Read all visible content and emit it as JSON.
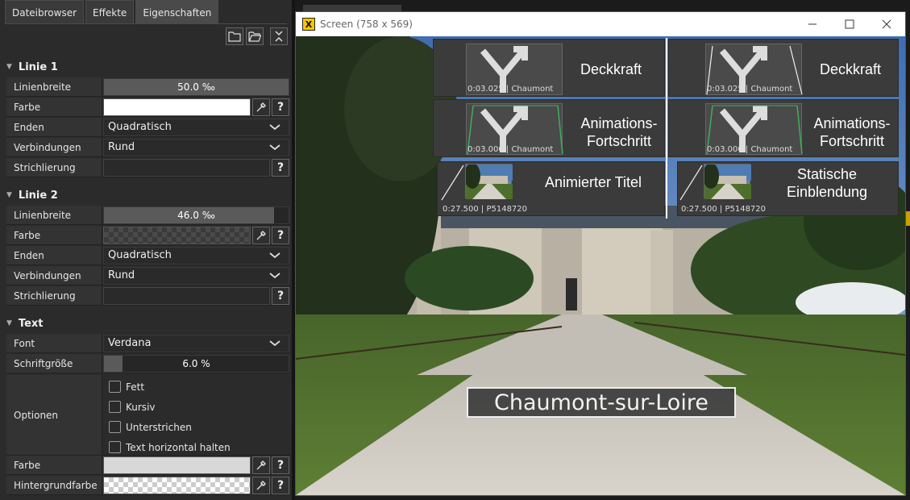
{
  "tabs": [
    "Dateibrowser",
    "Effekte",
    "Eigenschaften"
  ],
  "sections": {
    "linie1": "Linie 1",
    "linie2": "Linie 2",
    "text": "Text"
  },
  "linie1": {
    "linienbreite_label": "Linienbreite",
    "linienbreite_value": "50.0 ‰",
    "linienbreite_level": 1.0,
    "farbe_label": "Farbe",
    "enden_label": "Enden",
    "enden_value": "Quadratisch",
    "verbindungen_label": "Verbindungen",
    "verbindungen_value": "Rund",
    "strichlierung_label": "Strichlierung"
  },
  "linie2": {
    "linienbreite_label": "Linienbreite",
    "linienbreite_value": "46.0 ‰",
    "linienbreite_level": 0.92,
    "farbe_label": "Farbe",
    "enden_label": "Enden",
    "enden_value": "Quadratisch",
    "verbindungen_label": "Verbindungen",
    "verbindungen_value": "Rund",
    "strichlierung_label": "Strichlierung"
  },
  "text": {
    "font_label": "Font",
    "font_value": "Verdana",
    "schriftgroesse_label": "Schriftgröße",
    "schriftgroesse_value": "6.0 %",
    "schriftgroesse_level": 0.1,
    "optionen_label": "Optionen",
    "options": [
      "Fett",
      "Kursiv",
      "Unterstrichen",
      "Text horizontal halten"
    ],
    "farbe_label": "Farbe",
    "hintergrundfarbe_label": "Hintergrundfarbe"
  },
  "help_glyph": "?",
  "window": {
    "title": "Screen (758 x 569)",
    "app_icon_glyph": "X"
  },
  "tiles": [
    {
      "label": "Deckkraft",
      "meta": "0:03.025 | Chaumont"
    },
    {
      "label": "Deckkraft",
      "meta": "0:03.025 | Chaumont"
    },
    {
      "label": "Animations-\nFortschritt",
      "meta": "0:03.000 | Chaumont"
    },
    {
      "label": "Animations-\nFortschritt",
      "meta": "0:03.000 | Chaumont"
    },
    {
      "label": "Animierter Titel",
      "meta": "0:27.500 | P5148720"
    },
    {
      "label": "Statische\nEinblendung",
      "meta": "0:27.500 | P5148720"
    }
  ],
  "overlay_title": "Chaumont-sur-Loire",
  "colors": {
    "accent_green": "#3fae5a",
    "app_icon": "#f5c400",
    "panel_bg": "#2b2b2b"
  },
  "icons": {
    "toolbar": [
      "folder-icon",
      "folder-open-icon",
      "collapse-icon"
    ],
    "row_buttons": [
      "eyedropper-icon",
      "help-icon"
    ]
  }
}
